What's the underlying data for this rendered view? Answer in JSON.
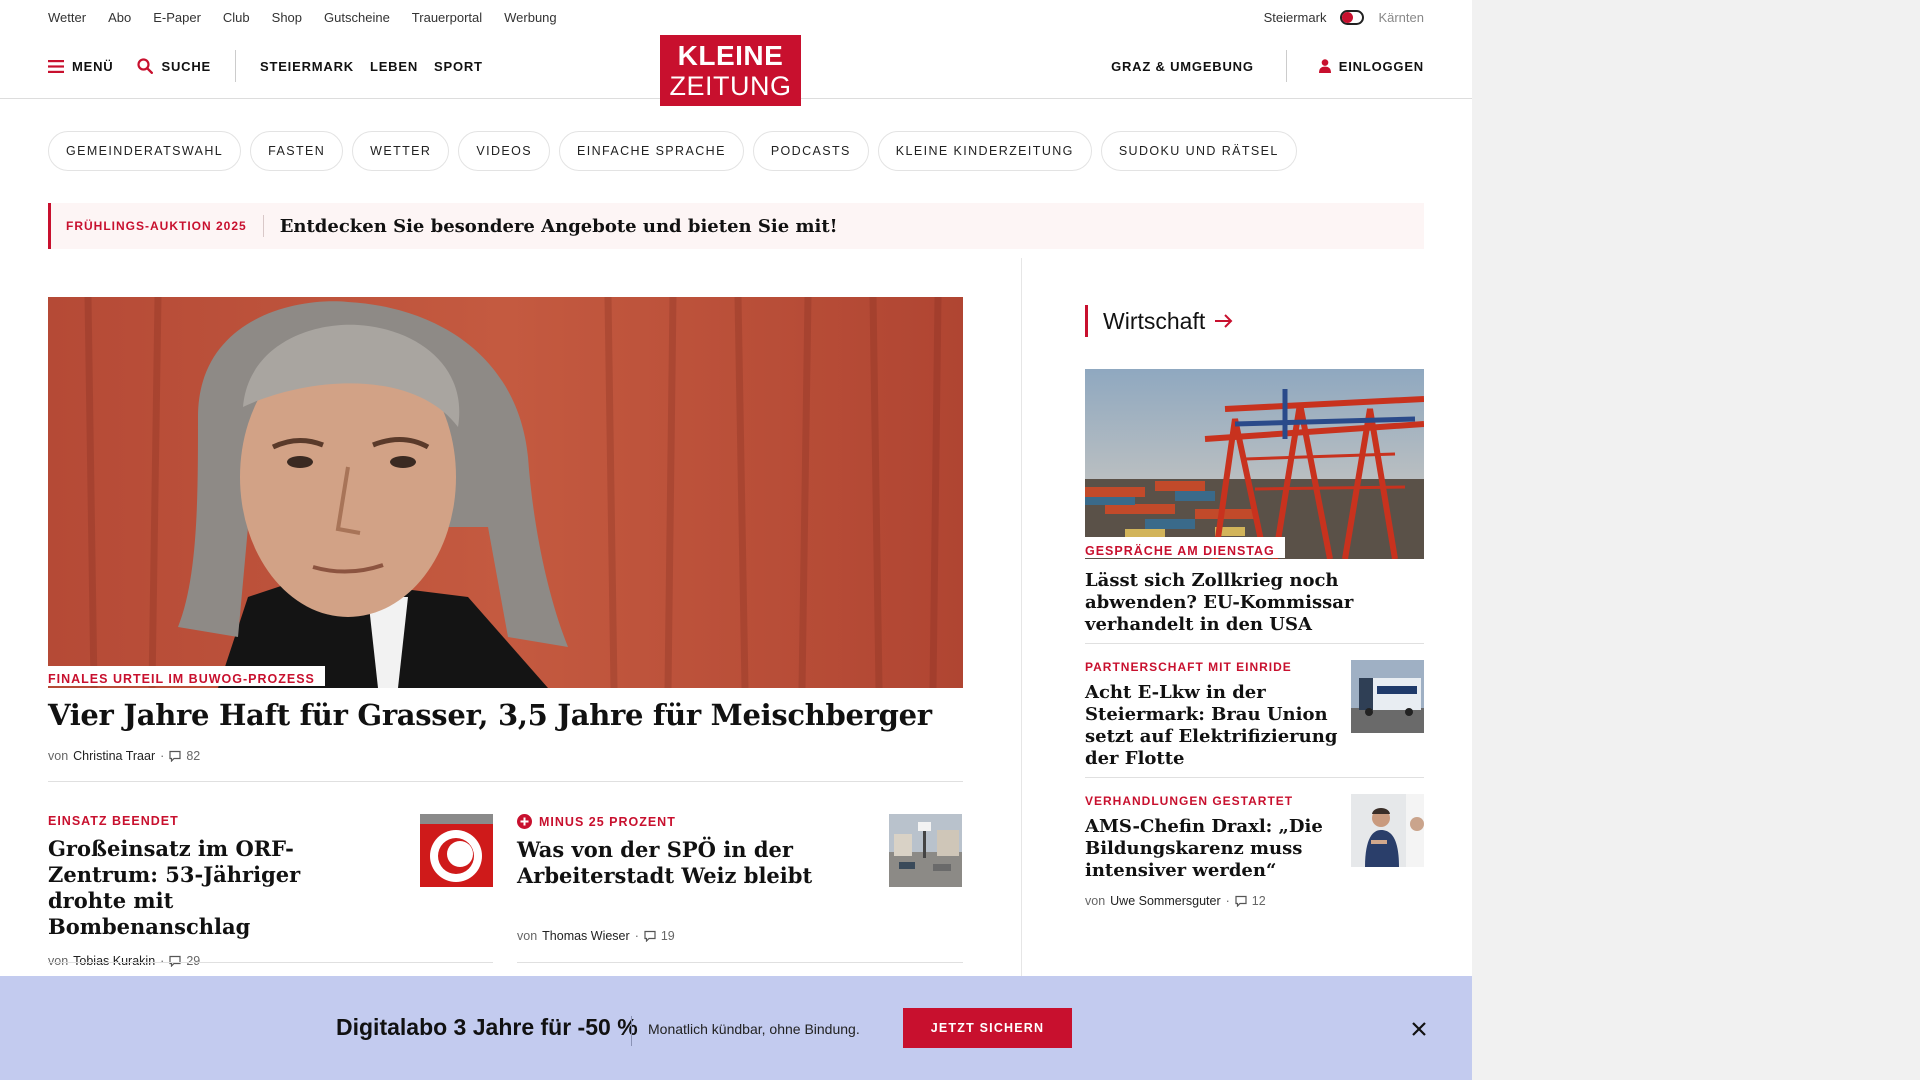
{
  "utility_bar": {
    "links": [
      "Wetter",
      "Abo",
      "E-Paper",
      "Club",
      "Shop",
      "Gutscheine",
      "Trauerportal",
      "Werbung"
    ],
    "region_active": "Steiermark",
    "region_inactive": "Kärnten"
  },
  "header": {
    "menu_label": "MENÜ",
    "search_label": "SUCHE",
    "nav": [
      "STEIERMARK",
      "LEBEN",
      "SPORT"
    ],
    "logo_line1": "KLEINE",
    "logo_line2": "ZEITUNG",
    "location_label": "GRAZ & UMGEBUNG",
    "login_label": "EINLOGGEN"
  },
  "topics": [
    "GEMEINDERATSWAHL",
    "FASTEN",
    "WETTER",
    "VIDEOS",
    "EINFACHE SPRACHE",
    "PODCASTS",
    "KLEINE KINDERZEITUNG",
    "SUDOKU UND RÄTSEL"
  ],
  "promo": {
    "tag": "FRÜHLINGS-AUKTION 2025",
    "text": "Entdecken Sie besondere Angebote und bieten Sie mit!"
  },
  "hero": {
    "kicker": "FINALES URTEIL IM BUWOG-PROZESS",
    "title": "Vier Jahre Haft für Grasser, 3,5 Jahre für Meischberger",
    "by": "von",
    "author": "Christina Traar",
    "comments": "82"
  },
  "stories": [
    {
      "kicker": "EINSATZ BEENDET",
      "title": "Großeinsatz im ORF-Zentrum: 53-Jähriger drohte mit Bombenanschlag",
      "by": "von",
      "author": "Tobias Kurakin",
      "comments": "29"
    },
    {
      "kicker": "MINUS 25 PROZENT",
      "title": "Was von der SPÖ in der Arbeiterstadt Weiz bleibt",
      "by": "von",
      "author": "Thomas Wieser",
      "comments": "19",
      "plus_icon": "plus-badge-icon"
    }
  ],
  "sidebar": {
    "section_title": "Wirtschaft",
    "lead": {
      "kicker": "GESPRÄCHE AM DIENSTAG",
      "title": "Lässt sich Zollkrieg noch abwenden? EU-Kommissar verhandelt in den USA"
    },
    "items": [
      {
        "kicker": "PARTNERSCHAFT MIT EINRIDE",
        "title": "Acht E-Lkw in der Steiermark: Brau Union setzt auf Elektrifizierung der Flotte"
      },
      {
        "kicker": "VERHANDLUNGEN GESTARTET",
        "title": "AMS-Chefin Draxl: „Die Bildungskarenz muss intensiver werden“",
        "by": "von",
        "author": "Uwe Sommersguter",
        "comments": "12"
      }
    ]
  },
  "subscribe_bar": {
    "headline": "Digitalabo 3 Jahre für -50 %",
    "note": "Monatlich kündbar, ohne Bindung.",
    "cta": "JETZT SICHERN"
  },
  "colors": {
    "brand_red": "#c8102e",
    "subscribe_bg": "#c3cbef",
    "promo_bg": "#fdf5f5"
  }
}
